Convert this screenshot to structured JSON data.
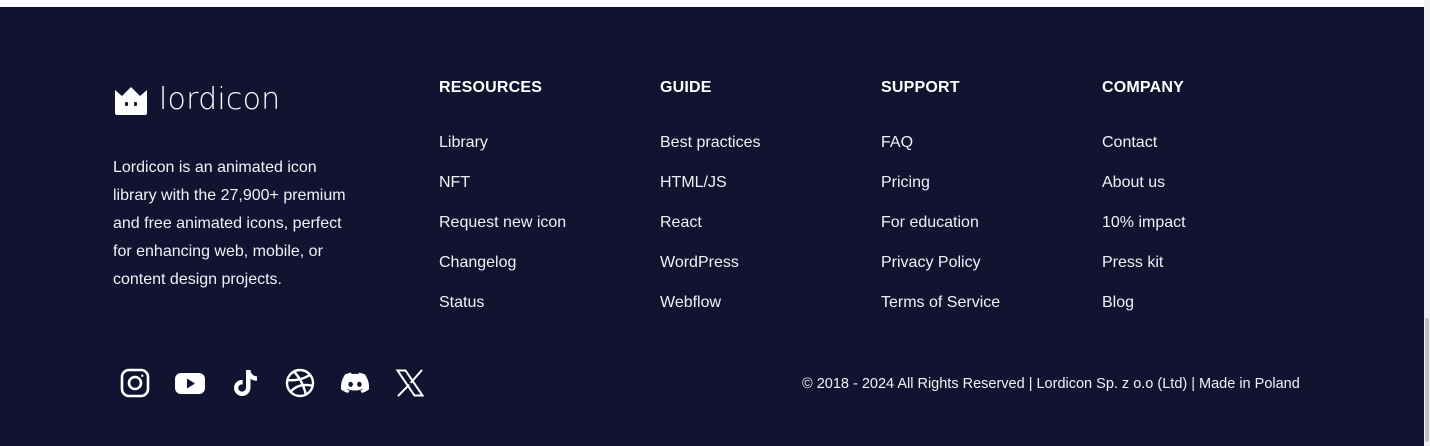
{
  "brand": {
    "name": "lordicon",
    "logo_icon": "crown-face-icon",
    "description": "Lordicon is an animated icon library with the 27,900+ premium and free animated icons, perfect for enhancing web, mobile, or content design projects."
  },
  "columns": [
    {
      "title": "RESOURCES",
      "links": [
        "Library",
        "NFT",
        "Request new icon",
        "Changelog",
        "Status"
      ]
    },
    {
      "title": "GUIDE",
      "links": [
        "Best practices",
        "HTML/JS",
        "React",
        "WordPress",
        "Webflow"
      ]
    },
    {
      "title": "SUPPORT",
      "links": [
        "FAQ",
        "Pricing",
        "For education",
        "Privacy Policy",
        "Terms of Service"
      ]
    },
    {
      "title": "COMPANY",
      "links": [
        "Contact",
        "About us",
        "10% impact",
        "Press kit",
        "Blog"
      ]
    }
  ],
  "socials": [
    {
      "icon": "instagram-icon"
    },
    {
      "icon": "youtube-icon"
    },
    {
      "icon": "tiktok-icon"
    },
    {
      "icon": "dribbble-icon"
    },
    {
      "icon": "discord-icon"
    },
    {
      "icon": "x-icon"
    }
  ],
  "copyright": "© 2018 - 2024 All Rights Reserved | Lordicon Sp. z o.o (Ltd) | Made in Poland",
  "colors": {
    "footer_bg": "#121330",
    "text": "#f1f1f6",
    "heading": "#ffffff"
  }
}
